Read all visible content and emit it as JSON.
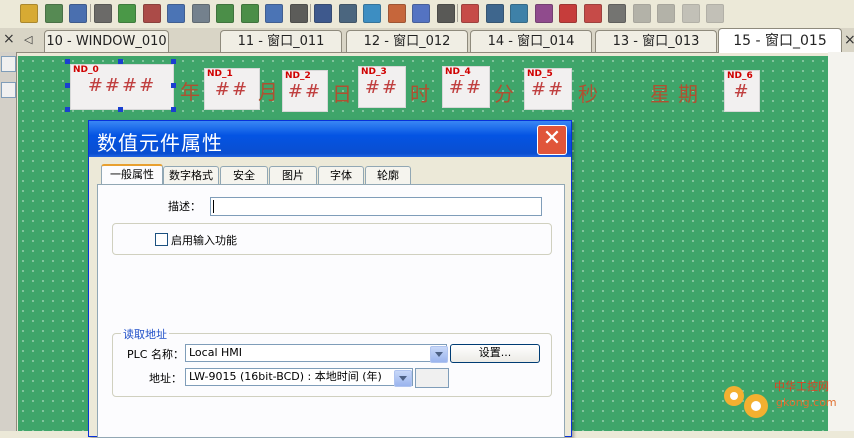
{
  "toolbar": {
    "icons": [
      "bulb-icon",
      "meter-icon",
      "bit-lamp-icon",
      "text-icon",
      "diamond-icon",
      "switch-icon",
      "numeric-input-icon",
      "slider-icon",
      "numeric-display-icon",
      "ascii-display-icon",
      "date-icon",
      "clock-icon",
      "function-key-icon",
      "window-icon",
      "move-icon",
      "multi-state-icon",
      "bar-chart-icon",
      "gauge-icon",
      "trend-icon",
      "table-icon",
      "picture-icon",
      "xy-plot-icon",
      "line-icon",
      "alarm-icon",
      "event-icon",
      "recipe-icon",
      "print-icon",
      "backup-icon",
      "security-icon"
    ]
  },
  "tabs": [
    {
      "label": "10 - WINDOW_010"
    },
    {
      "label": "11 - 窗口_011"
    },
    {
      "label": "12 - 窗口_012"
    },
    {
      "label": "14 - 窗口_014"
    },
    {
      "label": "13 - 窗口_013"
    },
    {
      "label": "15 - 窗口_015"
    }
  ],
  "tab_close": "×",
  "tab_scroll": "◁",
  "canvas": {
    "elements": [
      {
        "id": "ND_0",
        "value": "####"
      },
      {
        "id": "ND_1",
        "value": "##"
      },
      {
        "id": "ND_2",
        "value": "##"
      },
      {
        "id": "ND_3",
        "value": "##"
      },
      {
        "id": "ND_4",
        "value": "##"
      },
      {
        "id": "ND_5",
        "value": "##"
      },
      {
        "id": "ND_6",
        "value": "#"
      }
    ],
    "units": {
      "year": "年",
      "month": "月",
      "day": "日",
      "hour": "时",
      "minute": "分",
      "second": "秒",
      "weekday": "星期"
    }
  },
  "dialog": {
    "title": "数值元件属性",
    "close": "✕",
    "tabs": [
      "一般属性",
      "数字格式",
      "安全",
      "图片",
      "字体",
      "轮廓"
    ],
    "description_label": "描述：",
    "description_value": "",
    "enable_input_label": "启用输入功能",
    "read_address_label": "读取地址",
    "plc_name_label": "PLC 名称：",
    "plc_name_value": "Local HMI",
    "settings_button": "设置...",
    "address_label": "地址：",
    "address_value": "LW-9015 (16bit-BCD) : 本地时间 (年)"
  },
  "watermark": {
    "cn": "中华工控网",
    "en": "gkong.com"
  },
  "colors": {
    "canvas": "#3FA56A",
    "titlebar": "#0A4ED0",
    "close": "#E0553A",
    "unit_text": "#B05030",
    "id_text": "#D00000"
  }
}
